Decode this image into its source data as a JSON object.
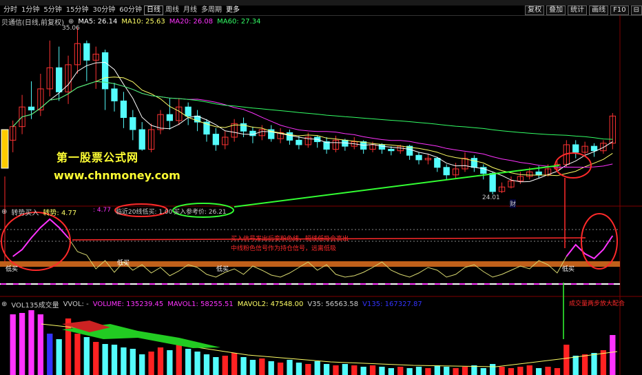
{
  "toolbar": {
    "periods": [
      "分时",
      "1分钟",
      "5分钟",
      "15分钟",
      "30分钟",
      "60分钟",
      "日线",
      "周线",
      "月线",
      "多周期",
      "更多"
    ],
    "active_period": "日线",
    "right_buttons": [
      "复权",
      "叠加",
      "统计",
      "画线",
      "F10",
      "⊟"
    ]
  },
  "main": {
    "title": "贝通信(日线,前复权)",
    "ma5": "MA5: 26.14",
    "ma10": "MA10: 25.63",
    "ma20": "MA20: 26.08",
    "ma60": "MA60: 27.34",
    "high_label": "35.06",
    "low_label": "24.01",
    "marker": "财",
    "watermark_cn": "第一股票公式网",
    "watermark_url": "www.chnmoney.com",
    "colors": {
      "up": "#ff3333",
      "down": "#54fcfc",
      "ma5": "#ffffff",
      "ma10": "#ffff66",
      "ma20": "#ff33ff",
      "ma60": "#33ff66"
    }
  },
  "indicator": {
    "name": "转势买入",
    "value1": "转势: 4.77",
    "value2": ": 4.77",
    "circled1": "临近20线低买: 1.00",
    "circled2": "买入参考价: 26.21",
    "note_line1": "买入信号发出后变粉色线，短线低吸会高出",
    "note_line2": "中线粉色信号作为持仓信号，远离低吸",
    "buy_labels": [
      "低买",
      "低买",
      "低买",
      "低买"
    ]
  },
  "volume": {
    "name": "VOL135成交量",
    "vvol": "VVOL: -",
    "volume": "VOLUME: 135239.45",
    "mavol1": "MAVOL1: 58255.51",
    "mavol2": "MAVOL2: 47548.00",
    "v35": "V35: 56563.58",
    "v135": "V135: 167327.87",
    "note": "成交量两步放大配合"
  }
}
